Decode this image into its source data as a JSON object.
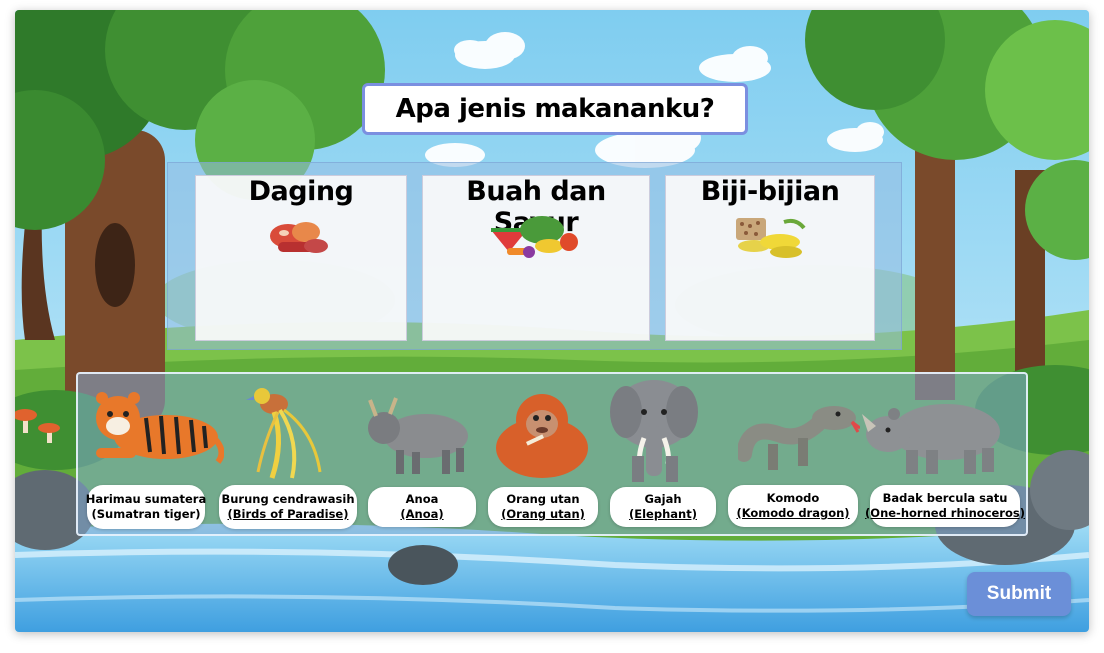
{
  "title": "Apa jenis makananku?",
  "categories": [
    {
      "label": "Daging",
      "icon": "meat-icon"
    },
    {
      "label": "Buah dan Sayur",
      "icon": "fruits-vegetables-icon"
    },
    {
      "label": "Biji-bijian",
      "icon": "grains-icon"
    }
  ],
  "animals": [
    {
      "name": "Harimau sumatera",
      "english": "(Sumatran tiger)",
      "icon": "tiger-icon"
    },
    {
      "name": "Burung cendrawasih",
      "english": "(Birds of Paradise)",
      "icon": "bird-of-paradise-icon"
    },
    {
      "name": "Anoa",
      "english": "(Anoa)",
      "icon": "anoa-icon"
    },
    {
      "name": "Orang utan",
      "english": "(Orang utan)",
      "icon": "orangutan-icon"
    },
    {
      "name": "Gajah",
      "english": "(Elephant)",
      "icon": "elephant-icon"
    },
    {
      "name": "Komodo",
      "english": "(Komodo dragon)",
      "icon": "komodo-icon"
    },
    {
      "name": "Badak bercula satu",
      "english": "(One-horned rhinoceros)",
      "icon": "rhinoceros-icon"
    }
  ],
  "submit_label": "Submit",
  "colors": {
    "accent": "#6b8fd8",
    "title_border": "#7b8fe0",
    "sky": "#8fd3ef",
    "grass": "#7cc24a",
    "water": "#5fb4e8"
  }
}
